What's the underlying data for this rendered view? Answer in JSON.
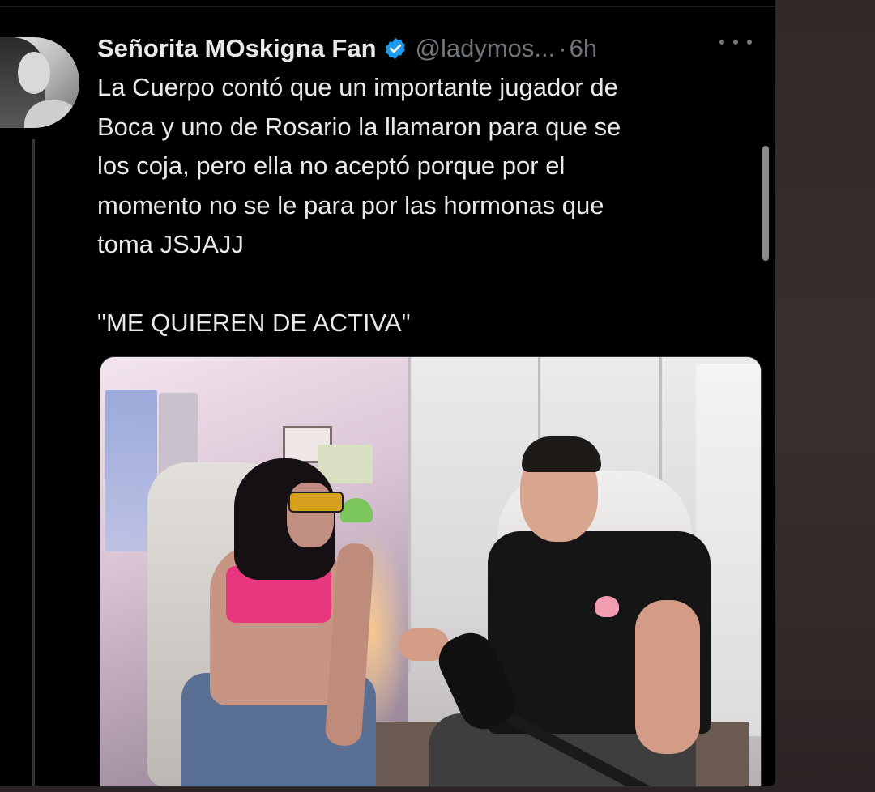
{
  "tweet": {
    "display_name": "Señorita MOskigna Fan",
    "handle": "@ladymos...",
    "separator": "·",
    "time": "6h",
    "text": "La Cuerpo contó que un importante jugador de\nBoca y uno de Rosario la llamaron para que se\nlos coja, pero ella no aceptó porque por el\nmomento no se le para por las hormonas que\ntoma JSJAJJ\n\n\"ME QUIEREN DE ACTIVA\"",
    "verified_icon": "verified-badge-icon",
    "more_icon": "more-options-icon"
  },
  "colors": {
    "background": "#000000",
    "text_primary": "#e7e9ea",
    "text_secondary": "#71767b",
    "verified_blue": "#1d9bf0",
    "outer_frame": "#2a2323"
  }
}
